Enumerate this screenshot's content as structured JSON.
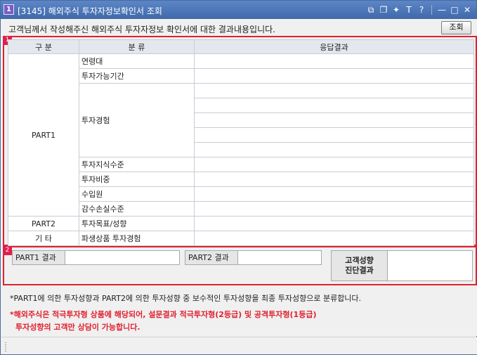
{
  "window": {
    "badge": "1",
    "title": "[3145] 해외주식 투자자정보확인서 조회",
    "controls": [
      "⧉",
      "❐",
      "✦",
      "T",
      "?",
      "—",
      "□",
      "✕"
    ]
  },
  "infobar": {
    "message": "고객님께서 작성해주신 해외주식 투자자정보 확인서에 대한 결과내용입니다.",
    "query_button": "조회"
  },
  "section1": {
    "badge": "1",
    "headers": {
      "category": "구 분",
      "type": "분 류",
      "result": "응답결과"
    },
    "part1": {
      "label": "PART1",
      "items": [
        "연령대",
        "투자가능기간",
        "투자경험",
        "투자지식수준",
        "투자비중",
        "수입원",
        "감수손실수준"
      ]
    },
    "part2": {
      "label": "PART2",
      "item": "투자목표/성향"
    },
    "etc": {
      "label": "기 타",
      "item": "파생상품 투자경험"
    }
  },
  "section2": {
    "badge": "2",
    "part1_result_label": "PART1 결과",
    "part1_result_value": "",
    "part2_result_label": "PART2 결과",
    "part2_result_value": "",
    "diagnosis_label_line1": "고객성향",
    "diagnosis_label_line2": "진단결과",
    "diagnosis_value": ""
  },
  "notes": {
    "note1": "*PART1에 의한 투자성향과 PART2에 의한 투자성향 중 보수적인 투자성향을 최종 투자성향으로 분류합니다.",
    "note2": "*해외주식은 적극투자형 상품에 해당되어, 설문결과 적극투자형(2등급) 및 공격투자형(1등급)",
    "note3": "투자성향의 고객만 상담이 가능합니다."
  },
  "colors": {
    "titlebar": "#4a73b4",
    "section_border": "#e0202e",
    "warning_text": "#e0202e",
    "table_header": "#e4e8ee"
  }
}
